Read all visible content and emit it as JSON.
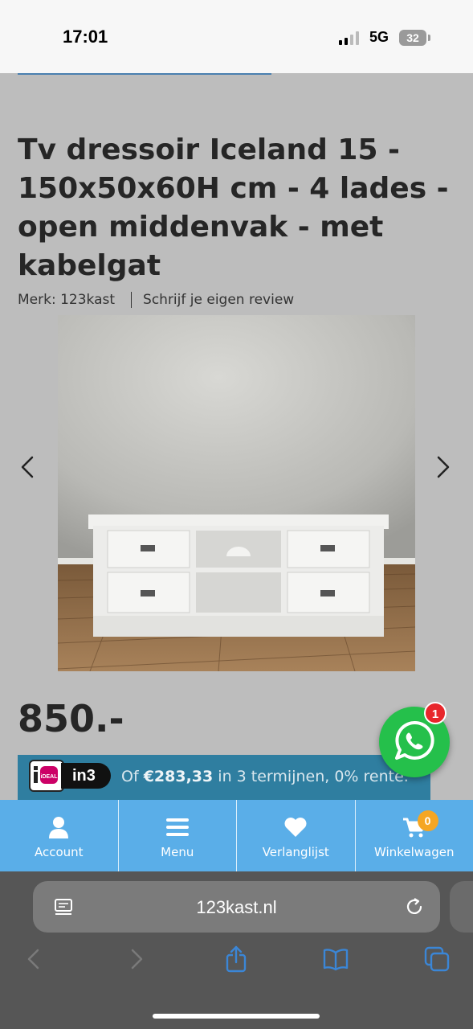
{
  "status_bar": {
    "time": "17:01",
    "network": "5G",
    "battery": "32"
  },
  "product": {
    "title": "Tv dressoir Iceland 15 - 150x50x60H cm - 4 lades - open middenvak - met kabelgat",
    "brand": "Merk: 123kast",
    "review_link": "Schrijf je eigen review",
    "price": "850.-"
  },
  "payment": {
    "ideal_label": "iDEAL",
    "in3_label": "in3",
    "prefix": "Of",
    "amount": "€283,33",
    "suffix": "in 3 termijnen, 0% rente."
  },
  "whatsapp": {
    "badge": "1"
  },
  "bottom_nav": {
    "items": [
      {
        "label": "Account",
        "icon": "user-icon"
      },
      {
        "label": "Menu",
        "icon": "menu-icon"
      },
      {
        "label": "Verlanglijst",
        "icon": "heart-icon"
      },
      {
        "label": "Winkelwagen",
        "icon": "cart-icon"
      }
    ],
    "cart_count": "0"
  },
  "browser": {
    "url": "123kast.nl"
  },
  "colors": {
    "nav_blue": "#5aaee8",
    "banner_blue": "#2f7ea0",
    "whatsapp_green": "#25c04b",
    "badge_red": "#e8262b",
    "cart_badge_orange": "#f5a623",
    "safari_blue": "#3b86d6"
  }
}
